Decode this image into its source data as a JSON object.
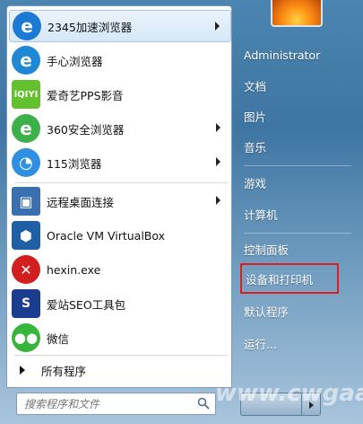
{
  "left_menu": {
    "items": [
      {
        "label": "2345加速浏览器",
        "icon": "2345-browser-icon",
        "color": "#1a7ad6",
        "has_arrow": true
      },
      {
        "label": "手心浏览器",
        "icon": "shouxin-browser-icon",
        "color": "#1e88d4",
        "has_arrow": false
      },
      {
        "label": "爱奇艺PPS影音",
        "icon": "iqiyi-pps-icon",
        "color": "#62c12c",
        "has_arrow": false
      },
      {
        "label": "360安全浏览器",
        "icon": "360-browser-icon",
        "color": "#3cb14a",
        "has_arrow": true
      },
      {
        "label": "115浏览器",
        "icon": "115-browser-icon",
        "color": "#2f8fe0",
        "has_arrow": true
      },
      {
        "label": "远程桌面连接",
        "icon": "remote-desktop-icon",
        "color": "#3a6fb0",
        "has_arrow": true
      },
      {
        "label": "Oracle VM VirtualBox",
        "icon": "virtualbox-icon",
        "color": "#1f5fa6",
        "has_arrow": false
      },
      {
        "label": "hexin.exe",
        "icon": "hexin-icon",
        "color": "#d21e1e",
        "has_arrow": false
      },
      {
        "label": "爱站SEO工具包",
        "icon": "aizhan-seo-icon",
        "color": "#1b3d8f",
        "has_arrow": false
      },
      {
        "label": "微信",
        "icon": "wechat-icon",
        "color": "#35b63a",
        "has_arrow": false
      }
    ],
    "all_programs": "所有程序",
    "search_placeholder": "搜索程序和文件"
  },
  "right_menu": {
    "items": [
      "Administrator",
      "文档",
      "图片",
      "音乐",
      "游戏",
      "计算机",
      "控制面板",
      "设备和打印机",
      "默认程序",
      "运行..."
    ],
    "highlighted_index": 7,
    "highlight_color": "#e31b23"
  },
  "watermark": "www.cwgaa.c"
}
